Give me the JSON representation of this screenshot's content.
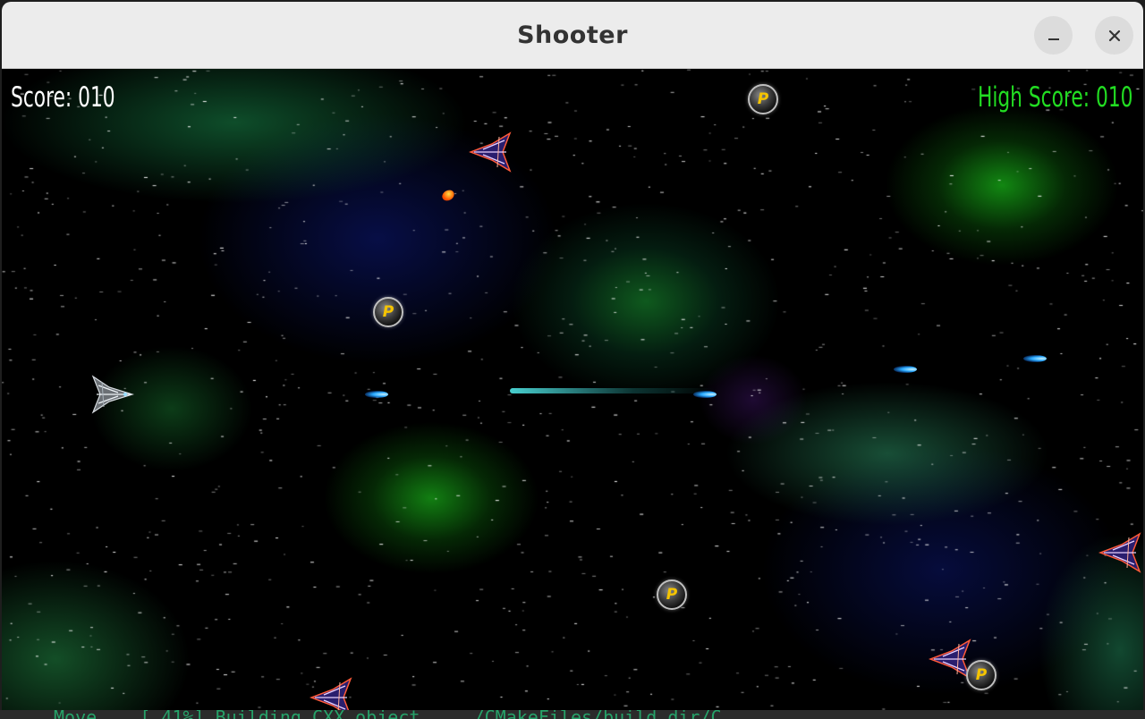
{
  "window": {
    "title": "Shooter",
    "minimize_icon": "minimize-icon",
    "close_icon": "close-icon"
  },
  "hud": {
    "score_label": "Score: 010",
    "high_score_label": "High Score: 010",
    "score_color": "#ffffff",
    "high_score_color": "#22dd22"
  },
  "sprites": {
    "player": "player-fighter-ship",
    "enemy": "enemy-fighter-ship",
    "enemy_count": 4,
    "powerup_letter": "P",
    "powerup_count": 4,
    "player_bullet": "blue-plasma-bolt",
    "enemy_bullet": "orange-fireball"
  },
  "colors": {
    "space": "#000000",
    "nebula_green": "#149614",
    "nebula_blue": "#0a1464",
    "powerup_letter": "#f5c400",
    "bolt": "#28a8ff"
  },
  "terminal": {
    "text": "Move... [ 41%] Building CXX object ... /CMakeFiles/build_dir/C..."
  }
}
